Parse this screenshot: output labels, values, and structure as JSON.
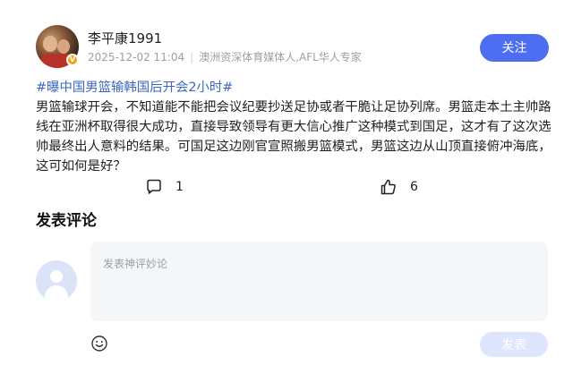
{
  "author": {
    "name": "李平康1991",
    "date": "2025-12-02 11:04",
    "separator": "|",
    "description": "澳洲资深体育媒体人,AFL华人专家"
  },
  "follow_label": "关注",
  "post": {
    "hashtag": "#曝中国男篮输韩国后开会2小时#",
    "text": "男篮输球开会，不知道能不能把会议纪要抄送足协或者干脆让足协列席。男篮走本土主帅路线在亚洲杯取得很大成功，直接导致领导有更大信心推广这种模式到国足，这才有了这次选帅最终出人意料的结果。可国足这边刚官宣照搬男篮模式，男篮这边从山顶直接俯冲海底，这可如何是好？"
  },
  "actions": {
    "comments": {
      "icon": "comment-bubble-icon",
      "count": "1"
    },
    "likes": {
      "icon": "thumbs-up-icon",
      "count": "6"
    }
  },
  "comment_section": {
    "title": "发表评论",
    "placeholder": "发表神评妙论",
    "submit_label": "发表",
    "emoji_icon": "smiley-icon"
  },
  "colors": {
    "accent": "#4e6ef2",
    "hashtag": "#3a66c4",
    "submit_disabled": "#dee6fd",
    "badge": "#f3a21b"
  }
}
